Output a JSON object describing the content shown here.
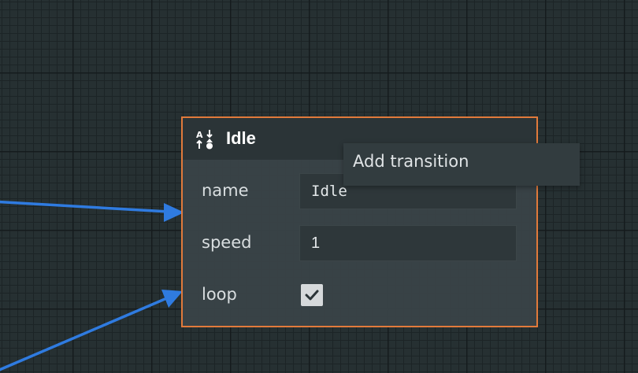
{
  "node": {
    "title": "Idle",
    "icon": "sort-arrows-shapes-icon",
    "border_color": "#e17a3b",
    "properties": [
      {
        "label": "name",
        "value": "Idle"
      },
      {
        "label": "speed",
        "value": "1"
      },
      {
        "label": "loop",
        "checked": true
      }
    ]
  },
  "context_menu": {
    "items": [
      {
        "label": "Add transition"
      }
    ]
  },
  "colors": {
    "edge": "#2f7be0",
    "canvas": "#263032",
    "accent": "#e17a3b"
  }
}
